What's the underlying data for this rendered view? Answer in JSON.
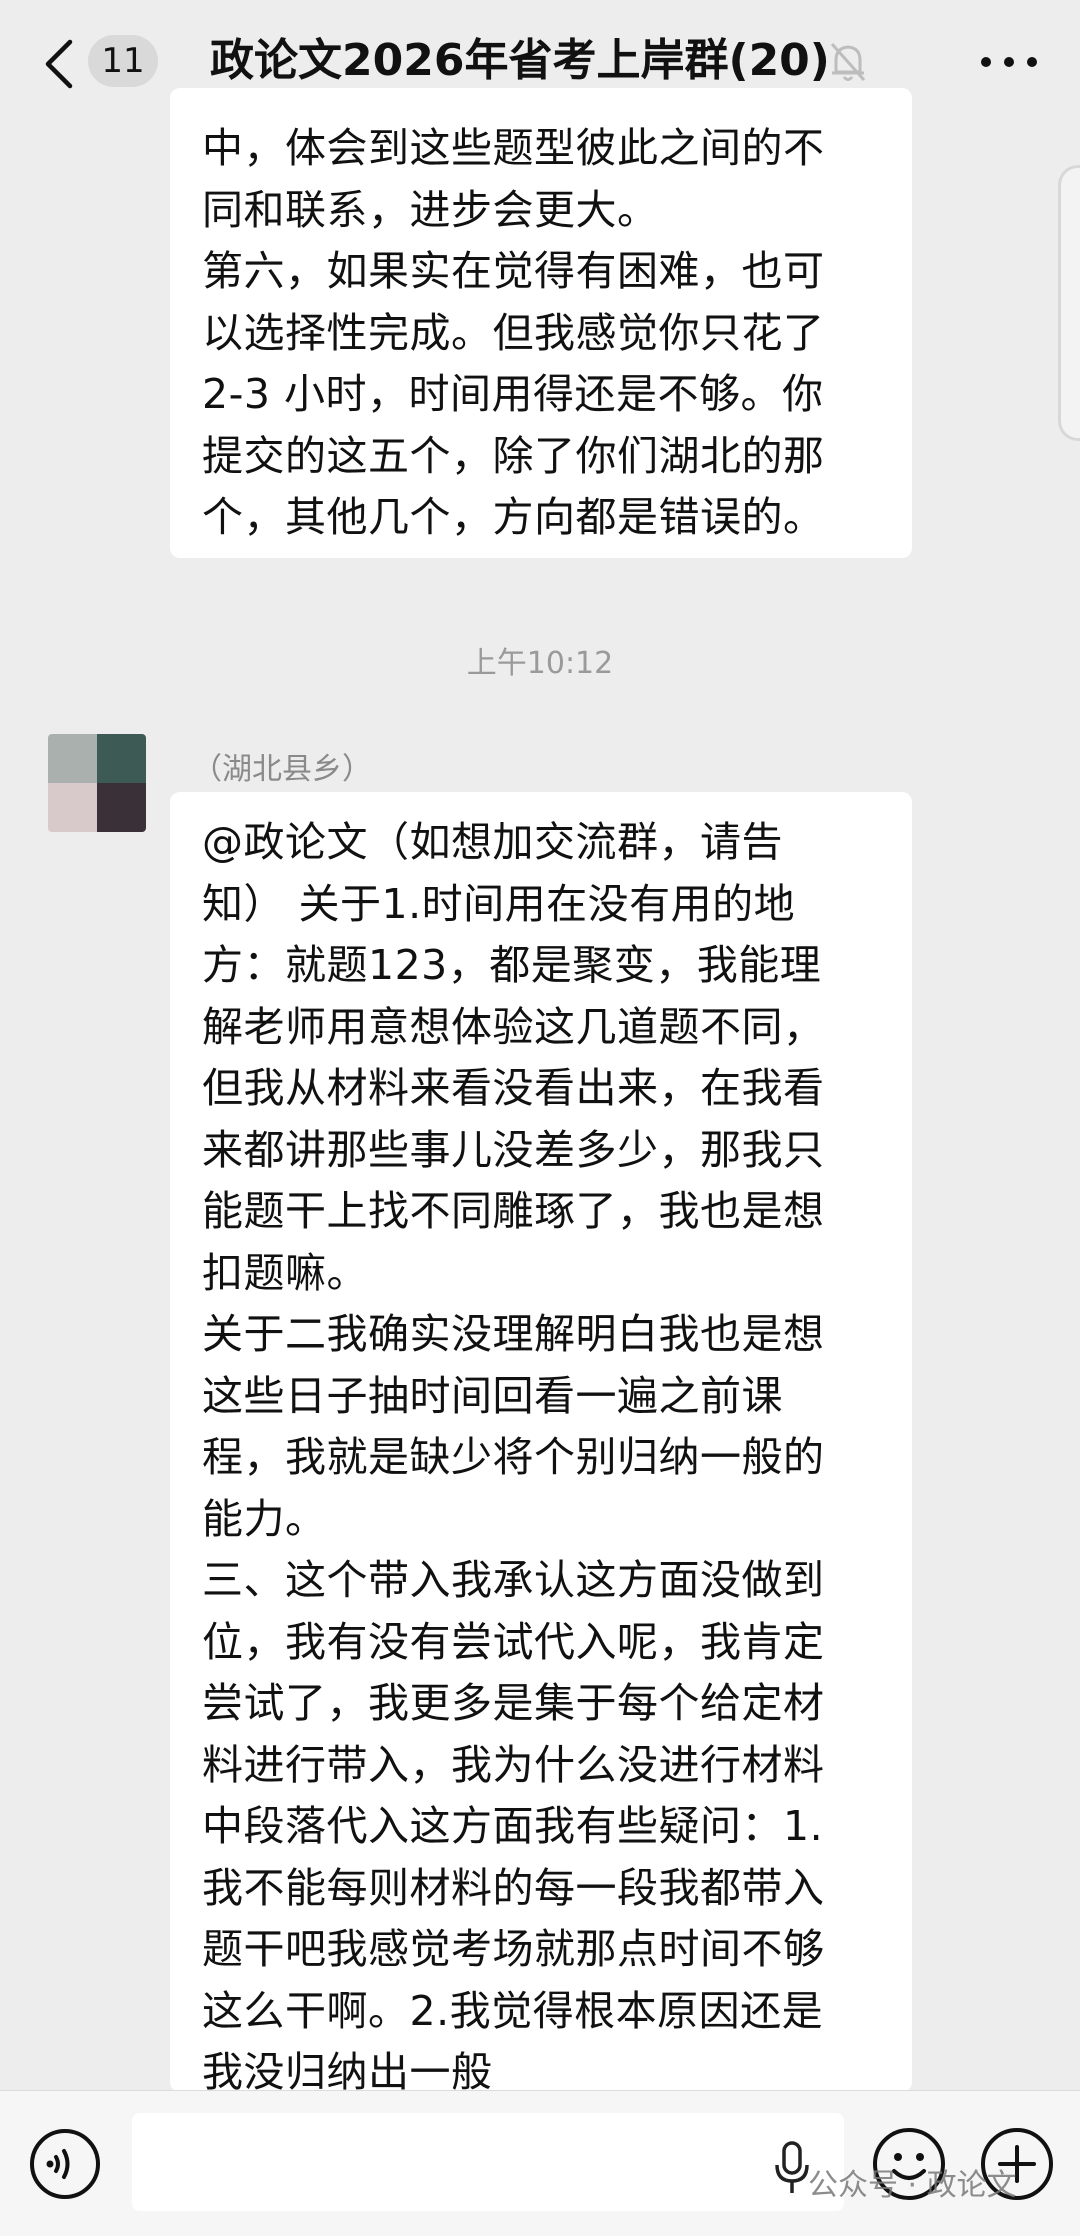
{
  "header": {
    "unread_count": "11",
    "title": "政论文2026年省考上岸群(20)"
  },
  "messages": [
    {
      "text": "中，体会到这些题型彼此之间的不\n同和联系，进步会更大。\n第六，如果实在觉得有困难，也可\n以选择性完成。但我感觉你只花了\n2-3 小时，时间用得还是不够。你\n提交的这五个，除了你们湖北的那\n个，其他几个，方向都是错误的。"
    },
    {
      "timestamp": "上午10:12",
      "sender": "（湖北县乡）",
      "avatar_colors": [
        "#a9b0ad",
        "#3e5a55",
        "#d8c9ca",
        "#3a3038"
      ],
      "text": "@政论文（如想加交流群，请告\n知） 关于1.时间用在没有用的地\n方：就题123，都是聚变，我能理\n解老师用意想体验这几道题不同，\n但我从材料来看没看出来，在我看\n来都讲那些事儿没差多少，那我只\n能题干上找不同雕琢了，我也是想\n扣题嘛。\n关于二我确实没理解明白我也是想\n这些日子抽时间回看一遍之前课\n程，我就是缺少将个别归纳一般的\n能力。\n三、这个带入我承认这方面没做到\n位，我有没有尝试代入呢，我肯定\n尝试了，我更多是集于每个给定材\n料进行带入，我为什么没进行材料\n中段落代入这方面我有些疑问：1.\n我不能每则材料的每一段我都带入\n题干吧我感觉考场就那点时间不够\n这么干啊。2.我觉得根本原因还是\n我没归纳出一般"
    }
  ],
  "input_bar": {
    "placeholder": ""
  },
  "watermark": "公众号 · 政论文",
  "colors": {
    "background": "#ededed",
    "bubble": "#ffffff",
    "timestamp": "#9a9a9a"
  },
  "icons": [
    "chevron-left-icon",
    "mute-bell-icon",
    "more-dots-icon",
    "voice-icon",
    "mic-icon",
    "emoji-icon",
    "plus-icon"
  ]
}
